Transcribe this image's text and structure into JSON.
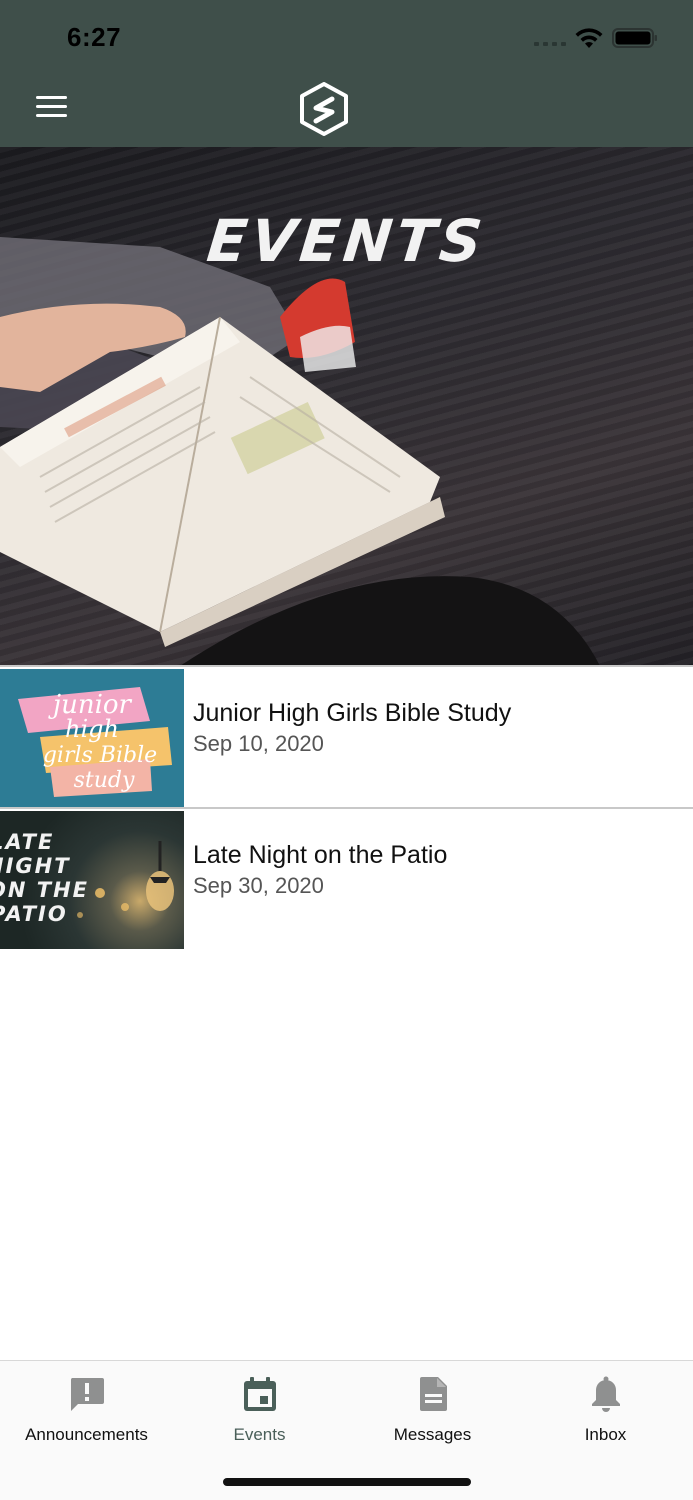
{
  "status_bar": {
    "time": "6:27"
  },
  "header": {
    "menu_icon": "hamburger-icon",
    "logo_icon": "s-hexagon-logo"
  },
  "hero": {
    "title": "EVENTS"
  },
  "events": [
    {
      "title": "Junior High Girls Bible Study",
      "date": "Sep 10, 2020",
      "thumb_text": [
        "junior",
        "high",
        "girls Bible",
        "study"
      ]
    },
    {
      "title": "Late Night on the Patio",
      "date": "Sep 30, 2020",
      "thumb_text": [
        "LATE",
        "NIGHT",
        "ON THE",
        "PATIO"
      ]
    }
  ],
  "tabs": [
    {
      "label": "Announcements",
      "icon": "announcement-icon",
      "active": false
    },
    {
      "label": "Events",
      "icon": "calendar-icon",
      "active": true
    },
    {
      "label": "Messages",
      "icon": "document-icon",
      "active": false
    },
    {
      "label": "Inbox",
      "icon": "bell-icon",
      "active": false
    }
  ],
  "colors": {
    "header": "#3f4f4a",
    "active_tab": "#4a5f59",
    "inactive_tab_icon": "#8f9090"
  }
}
